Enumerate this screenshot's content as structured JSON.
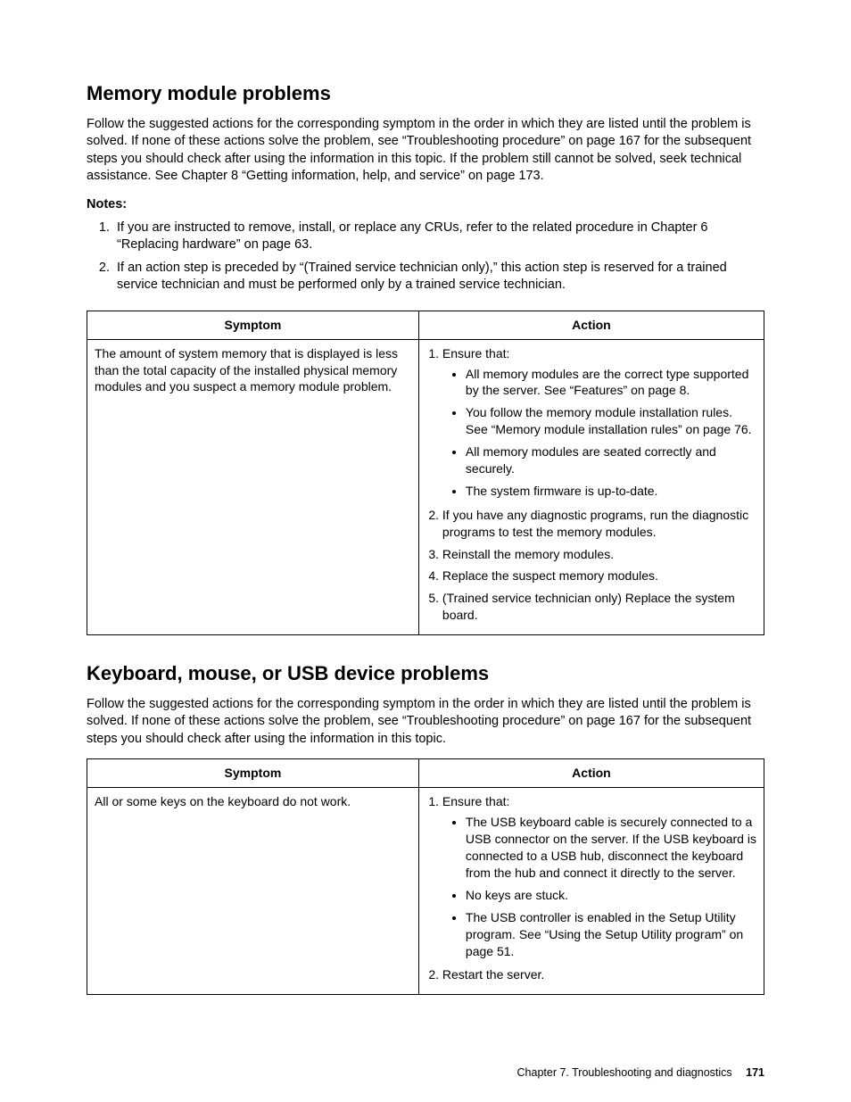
{
  "section1": {
    "heading": "Memory module problems",
    "intro": "Follow the suggested actions for the corresponding symptom in the order in which they are listed until the problem is solved. If none of these actions solve the problem, see “Troubleshooting procedure” on page 167 for the subsequent steps you should check after using the information in this topic. If the problem still cannot be solved, seek technical assistance. See Chapter 8 “Getting information, help, and service” on page 173.",
    "notes_label": "Notes:",
    "notes": [
      "If you are instructed to remove, install, or replace any CRUs, refer to the related procedure in Chapter 6 “Replacing hardware” on page 63.",
      "If an action step is preceded by “(Trained service technician only),” this action step is reserved for a trained service technician and must be performed only by a trained service technician."
    ],
    "table": {
      "col_symptom": "Symptom",
      "col_action": "Action",
      "symptom": "The amount of system memory that is displayed is less than the total capacity of the installed physical memory modules and you suspect a memory module problem.",
      "a1": "Ensure that:",
      "a1_bullets": [
        "All memory modules are the correct type supported by the server. See “Features” on page 8.",
        "You follow the memory module installation rules. See “Memory module installation rules” on page 76.",
        "All memory modules are seated correctly and securely.",
        "The system firmware is up-to-date."
      ],
      "a2": "If you have any diagnostic programs, run the diagnostic programs to test the memory modules.",
      "a3": "Reinstall the memory modules.",
      "a4": "Replace the suspect memory modules.",
      "a5": "(Trained service technician only) Replace the system board."
    }
  },
  "section2": {
    "heading": "Keyboard, mouse, or USB device problems",
    "intro": "Follow the suggested actions for the corresponding symptom in the order in which they are listed until the problem is solved. If none of these actions solve the problem, see “Troubleshooting procedure” on page 167 for the subsequent steps you should check after using the information in this topic.",
    "table": {
      "col_symptom": "Symptom",
      "col_action": "Action",
      "symptom": "All or some keys on the keyboard do not work.",
      "a1": "Ensure that:",
      "a1_bullets": [
        "The USB keyboard cable is securely connected to a USB connector on the server. If the USB keyboard is connected to a USB hub, disconnect the keyboard from the hub and connect it directly to the server.",
        "No keys are stuck.",
        "The USB controller is enabled in the Setup Utility program. See “Using the Setup Utility program” on page 51."
      ],
      "a2": "Restart the server."
    }
  },
  "footer": {
    "chapter": "Chapter 7. Troubleshooting and diagnostics",
    "page": "171"
  }
}
